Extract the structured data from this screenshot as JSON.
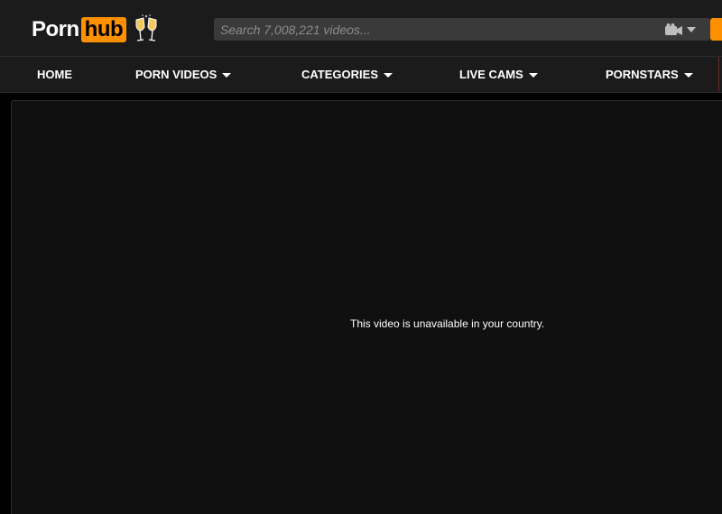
{
  "header": {
    "logo": {
      "part1": "Porn",
      "part2": "hub",
      "accent_color": "#ff9000",
      "icon": "champagne-glasses-icon"
    },
    "search": {
      "placeholder": "Search 7,008,221 videos...",
      "value": "",
      "camera_icon": "video-camera-icon",
      "dropdown_icon": "chevron-down-icon"
    }
  },
  "nav": {
    "items": [
      {
        "label": "HOME",
        "has_dropdown": false
      },
      {
        "label": "PORN VIDEOS",
        "has_dropdown": true
      },
      {
        "label": "CATEGORIES",
        "has_dropdown": true
      },
      {
        "label": "LIVE CAMS",
        "has_dropdown": true
      },
      {
        "label": "PORNSTARS",
        "has_dropdown": true
      }
    ]
  },
  "player": {
    "message": "This video is unavailable in your country."
  },
  "colors": {
    "background": "#000000",
    "header_bg": "#1b1b1b",
    "player_bg": "#101010",
    "search_bg": "#3a3a3a",
    "accent": "#ff9000"
  }
}
